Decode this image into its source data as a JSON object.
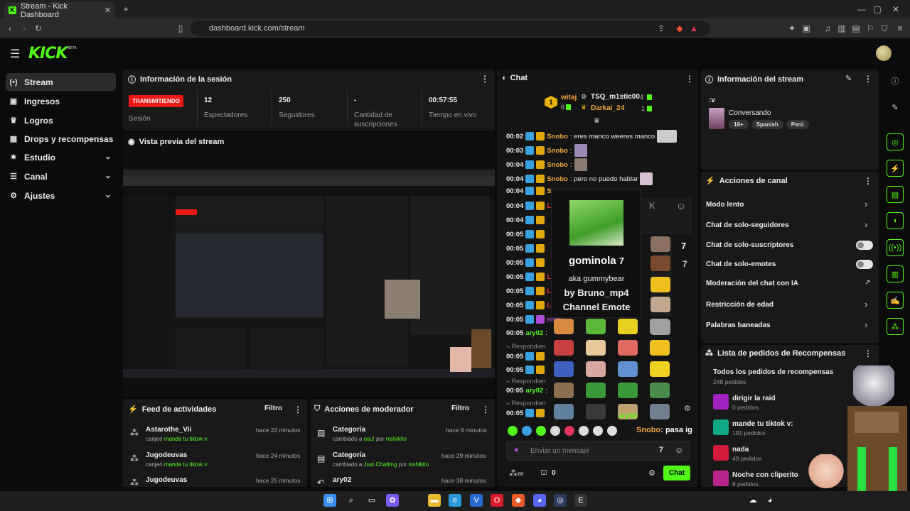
{
  "browser": {
    "tab_title": "Stream - Kick Dashboard",
    "tab_close": "✕",
    "new_tab": "+",
    "url": "dashboard.kick.com/stream",
    "win_min": "—",
    "win_max": "▢",
    "win_close": "✕"
  },
  "app": {
    "logo": "KICK",
    "beta": "BETA"
  },
  "sidebar": {
    "items": [
      {
        "label": "Stream",
        "icon": "stream-icon"
      },
      {
        "label": "Ingresos",
        "icon": "dollar-icon"
      },
      {
        "label": "Logros",
        "icon": "trophy-icon"
      },
      {
        "label": "Drops y recompensas",
        "icon": "gift-icon"
      },
      {
        "label": "Estudio",
        "icon": "gear-icon"
      },
      {
        "label": "Canal",
        "icon": "list-icon"
      },
      {
        "label": "Ajustes",
        "icon": "gear-icon"
      }
    ]
  },
  "session": {
    "title": "Información de la sesión",
    "live_badge": "TRANSMITIENDO",
    "session_label": "Sesión",
    "viewers_value": "12",
    "viewers_label": "Espectadores",
    "followers_value": "250",
    "followers_label": "Seguidores",
    "subs_value": "-",
    "subs_label_1": "Cantidad de",
    "subs_label_2": "suscripciones",
    "live_time_value": "00:57:55",
    "live_time_label": "Tiempo en vivo"
  },
  "preview": {
    "title": "Vista previa del stream"
  },
  "feed": {
    "title": "Feed de actividades",
    "filter": "Filtro",
    "rows": [
      {
        "name": "Astarothe_Vii",
        "pre": "canjeó",
        "reward": "mande tu tiktok v:",
        "time": "hace 22 minutos"
      },
      {
        "name": "Jugodeuvas",
        "pre": "canjeó",
        "reward": "mande tu tiktok v:",
        "time": "hace 24 minutos"
      },
      {
        "name": "Jugodeuvas",
        "pre": "",
        "reward": "",
        "time": "hace 25 minutos"
      }
    ]
  },
  "modactions": {
    "title": "Acciones de moderador",
    "filter": "Filtro",
    "rows": [
      {
        "name": "Categoría",
        "pre": "cambiado a",
        "val": "osu!",
        "by": "por",
        "mod": "nishikito",
        "time": "hace 9 minutos"
      },
      {
        "name": "Categoría",
        "pre": "cambiado a",
        "val": "Just Chatting",
        "by": "por",
        "mod": "nishikito",
        "time": "hace 29 minutos"
      },
      {
        "name": "ary02",
        "pre": "",
        "val": "",
        "by": "",
        "mod": "",
        "time": "hace 38 minutos"
      }
    ]
  },
  "chat": {
    "title": "Chat",
    "leader_rank": "1",
    "leader1": "witaj",
    "leader1_count": "6",
    "leader2": "TSQ_m1stic00",
    "leader2_count": "4",
    "leader3": "Darkai_24",
    "leader3_count": "1",
    "lines": [
      {
        "time": "00:02",
        "user": "Snobo",
        "text": ": eres manco weeres manco"
      },
      {
        "time": "00:03",
        "user": "Snobo",
        "text": ":"
      },
      {
        "time": "00:04",
        "user": "Snobo",
        "text": ":"
      },
      {
        "time": "00:04",
        "user": "Snobo",
        "text": ": pero no puedo hablar"
      },
      {
        "time": "00:04",
        "user": "Sn",
        "text": ""
      },
      {
        "time": "00:04",
        "user": "Levilthy",
        "text": ""
      },
      {
        "time": "00:04",
        "user": "",
        "text": ""
      },
      {
        "time": "00:05",
        "user": "",
        "text": ""
      },
      {
        "time": "00:05",
        "user": "",
        "text": ""
      },
      {
        "time": "00:05",
        "user": "",
        "text": ""
      },
      {
        "time": "00:05",
        "user": "Levilthy",
        "text": ""
      },
      {
        "time": "00:05",
        "user": "Levilthy",
        "text": ""
      },
      {
        "time": "00:05",
        "user": "Levilthy",
        "text": ""
      },
      {
        "time": "00:05",
        "user": "nishi",
        "text": ""
      },
      {
        "time": "00:05",
        "user": "ary02",
        "text": ":"
      }
    ],
    "respond1": "Respondien",
    "respond_time1": "00:05",
    "ary_line_time": "00:05",
    "ary_user": "ary02",
    "respond2": "Respondien",
    "respond_time2": "00:05",
    "respond3": "Respondien",
    "respond_time3": "00:05",
    "bottom_ary": "ary02",
    "bottom_snobo": "Snobo",
    "bottom_text": ": pasa ig",
    "input_placeholder": "Enviar un mensaje",
    "points": "0",
    "send": "Chat"
  },
  "emote_tooltip": {
    "name": "gominola",
    "aka": "aka gummybear",
    "by": "by Bruno_mp4",
    "type": "Channel Emote"
  },
  "stream_info": {
    "title": "Información del stream",
    "stream_title": ":v",
    "category": "Conversando",
    "tags": [
      "18+",
      "Spanish",
      "Perú"
    ]
  },
  "channel_actions": {
    "title": "Acciones de canal",
    "items": [
      "Modo lento",
      "Chat de solo-seguidores",
      "Chat de solo-suscriptores",
      "Chat de solo-emotes",
      "Moderación del chat con IA",
      "Restricción de edad",
      "Palabras baneadas"
    ]
  },
  "rewards": {
    "title": "Lista de pedidos de Recompensas",
    "all_label": "Todos los pedidos de recompensas",
    "all_count": "248 pedidos",
    "items": [
      {
        "name": "dirigir la raid",
        "count": "0 pedidos",
        "color": "#a020c0"
      },
      {
        "name": "mande tu tiktok v:",
        "count": "191 pedidos",
        "color": "#0fa884"
      },
      {
        "name": "nada",
        "count": "49 pedidos",
        "color": "#d21a3a"
      },
      {
        "name": "Noche con cliperito",
        "count": "8 pedidos",
        "color": "#b8258c"
      }
    ]
  },
  "colors": {
    "accent": "#53fc18",
    "live": "#e91916",
    "panel": "#191919"
  }
}
